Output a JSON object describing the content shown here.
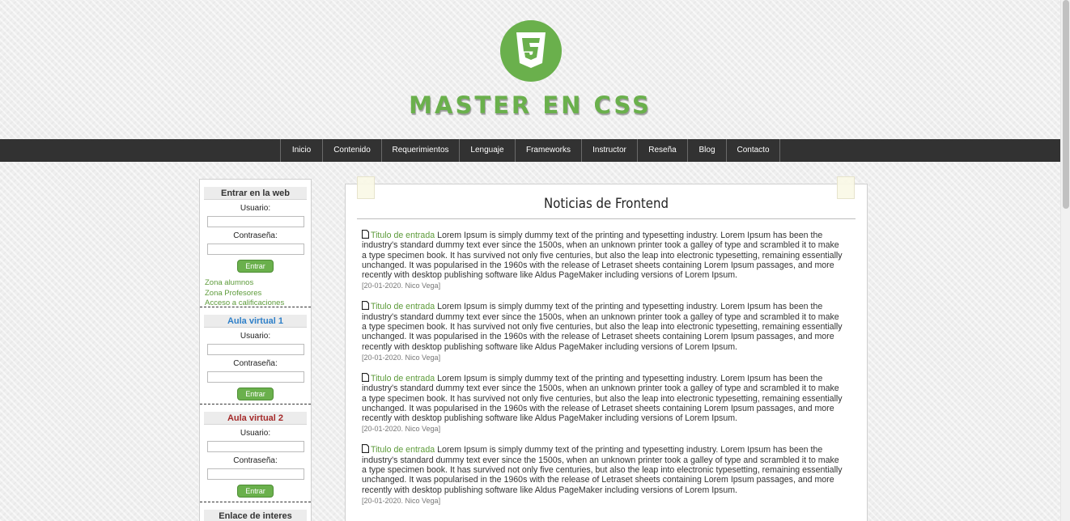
{
  "header": {
    "brand": "MASTER EN CSS",
    "logo_icon": "css3-icon",
    "brand_color": "#6ab04c"
  },
  "nav": {
    "items": [
      "Inicio",
      "Contenido",
      "Requerimientos",
      "Lenguaje",
      "Frameworks",
      "Instructor",
      "Reseña",
      "Blog",
      "Contacto"
    ]
  },
  "sidebar": {
    "login": {
      "title": "Entrar en la web",
      "user_label": "Usuario:",
      "password_label": "Contraseña:",
      "button": "Entrar",
      "links": [
        "Zona alumnos",
        "Zona Profesores",
        "Acceso a calificaciones"
      ]
    },
    "aula1": {
      "title": "Aula virtual 1",
      "user_label": "Usuario:",
      "password_label": "Contraseña:",
      "button": "Entrar"
    },
    "aula2": {
      "title": "Aula virtual 2",
      "user_label": "Usuario:",
      "password_label": "Contraseña:",
      "button": "Entrar"
    },
    "links_box": {
      "title": "Enlace de interes"
    }
  },
  "main": {
    "title": "Noticias de Frontend",
    "articles": [
      {
        "title": "Titulo de entrada",
        "body": "Lorem Ipsum is simply dummy text of the printing and typesetting industry. Lorem Ipsum has been the industry's standard dummy text ever since the 1500s, when an unknown printer took a galley of type and scrambled it to make a type specimen book. It has survived not only five centuries, but also the leap into electronic typesetting, remaining essentially unchanged. It was popularised in the 1960s with the release of Letraset sheets containing Lorem Ipsum passages, and more recently with desktop publishing software like Aldus PageMaker including versions of Lorem Ipsum.",
        "meta": "[20-01-2020. Nico Vega]"
      },
      {
        "title": "Titulo de entrada",
        "body": "Lorem Ipsum is simply dummy text of the printing and typesetting industry. Lorem Ipsum has been the industry's standard dummy text ever since the 1500s, when an unknown printer took a galley of type and scrambled it to make a type specimen book. It has survived not only five centuries, but also the leap into electronic typesetting, remaining essentially unchanged. It was popularised in the 1960s with the release of Letraset sheets containing Lorem Ipsum passages, and more recently with desktop publishing software like Aldus PageMaker including versions of Lorem Ipsum.",
        "meta": "[20-01-2020. Nico Vega]"
      },
      {
        "title": "Titulo de entrada",
        "body": "Lorem Ipsum is simply dummy text of the printing and typesetting industry. Lorem Ipsum has been the industry's standard dummy text ever since the 1500s, when an unknown printer took a galley of type and scrambled it to make a type specimen book. It has survived not only five centuries, but also the leap into electronic typesetting, remaining essentially unchanged. It was popularised in the 1960s with the release of Letraset sheets containing Lorem Ipsum passages, and more recently with desktop publishing software like Aldus PageMaker including versions of Lorem Ipsum.",
        "meta": "[20-01-2020. Nico Vega]"
      },
      {
        "title": "Titulo de entrada",
        "body": "Lorem Ipsum is simply dummy text of the printing and typesetting industry. Lorem Ipsum has been the industry's standard dummy text ever since the 1500s, when an unknown printer took a galley of type and scrambled it to make a type specimen book. It has survived not only five centuries, but also the leap into electronic typesetting, remaining essentially unchanged. It was popularised in the 1960s with the release of Letraset sheets containing Lorem Ipsum passages, and more recently with desktop publishing software like Aldus PageMaker including versions of Lorem Ipsum.",
        "meta": "[20-01-2020. Nico Vega]"
      }
    ]
  }
}
